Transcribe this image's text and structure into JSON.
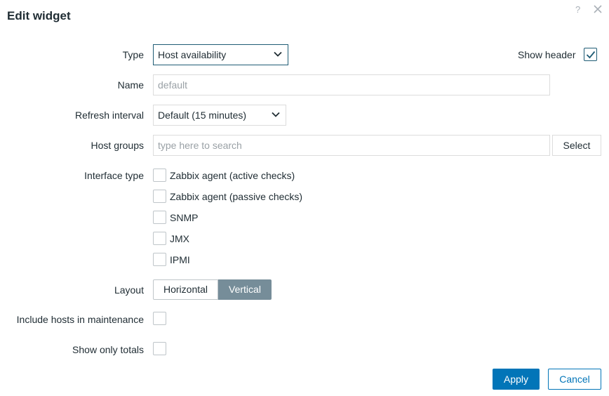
{
  "dialog": {
    "title": "Edit widget",
    "help_glyph": "?"
  },
  "form": {
    "type": {
      "label": "Type",
      "value": "Host availability"
    },
    "show_header": {
      "label": "Show header",
      "checked": true
    },
    "name": {
      "label": "Name",
      "placeholder": "default",
      "value": ""
    },
    "refresh": {
      "label": "Refresh interval",
      "value": "Default (15 minutes)"
    },
    "host_groups": {
      "label": "Host groups",
      "placeholder": "type here to search",
      "select_label": "Select"
    },
    "interface_type": {
      "label": "Interface type",
      "options": [
        {
          "label": "Zabbix agent (active checks)",
          "checked": false
        },
        {
          "label": "Zabbix agent (passive checks)",
          "checked": false
        },
        {
          "label": "SNMP",
          "checked": false
        },
        {
          "label": "JMX",
          "checked": false
        },
        {
          "label": "IPMI",
          "checked": false
        }
      ]
    },
    "layout": {
      "label": "Layout",
      "options": [
        "Horizontal",
        "Vertical"
      ],
      "selected": "Vertical"
    },
    "include_maintenance": {
      "label": "Include hosts in maintenance",
      "checked": false
    },
    "show_only_totals": {
      "label": "Show only totals",
      "checked": false
    }
  },
  "footer": {
    "apply_label": "Apply",
    "cancel_label": "Cancel"
  },
  "colors": {
    "primary": "#0275b8",
    "segment_active": "#768d99",
    "focus_border": "#1f5c75"
  },
  "icons": {
    "help": "help-icon",
    "close": "close-icon",
    "chevron": "chevron-down-icon",
    "check": "checkmark-icon"
  }
}
